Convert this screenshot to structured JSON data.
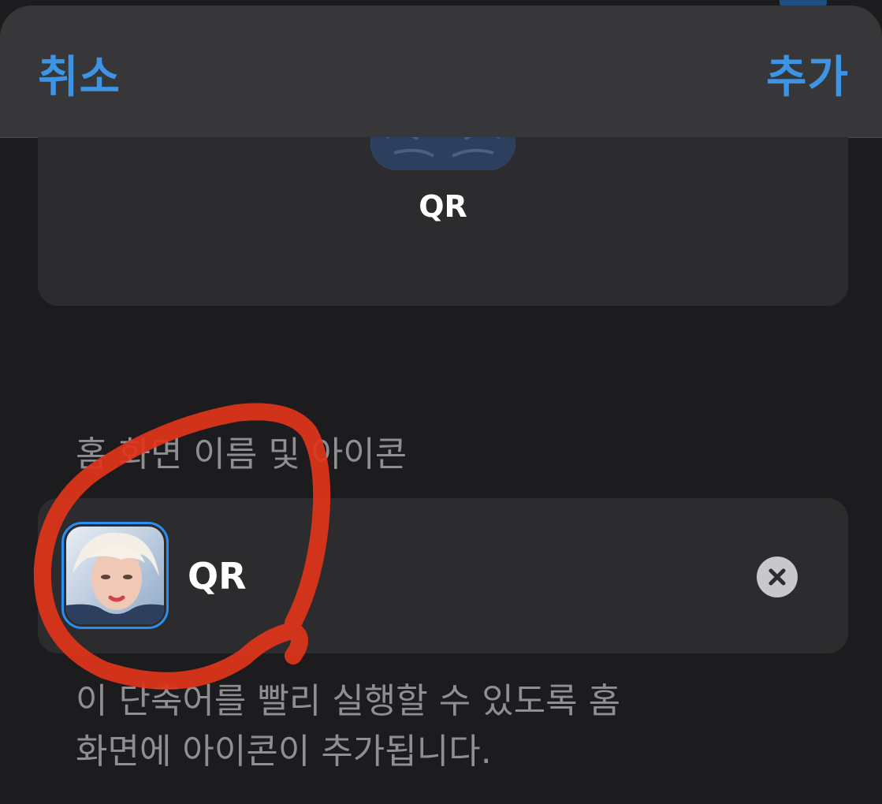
{
  "navbar": {
    "cancel_label": "취소",
    "add_label": "추가"
  },
  "preview": {
    "label": "QR",
    "icon": "portrait-icon"
  },
  "section": {
    "header": "홈 화면 이름 및 아이콘"
  },
  "name_row": {
    "value": "QR",
    "icon": "portrait-icon",
    "clear_icon": "clear-icon"
  },
  "footer": {
    "line1": "이 단축어를 빨리 실행할 수 있도록 홈",
    "line2": "화면에 아이콘이 추가됩니다."
  },
  "colors": {
    "accent": "#3d93e4",
    "background": "#1c1c1e",
    "card": "#2c2c2e",
    "navbar": "#373739",
    "secondary_text": "#8e8e93",
    "annotation": "#e0341a"
  }
}
